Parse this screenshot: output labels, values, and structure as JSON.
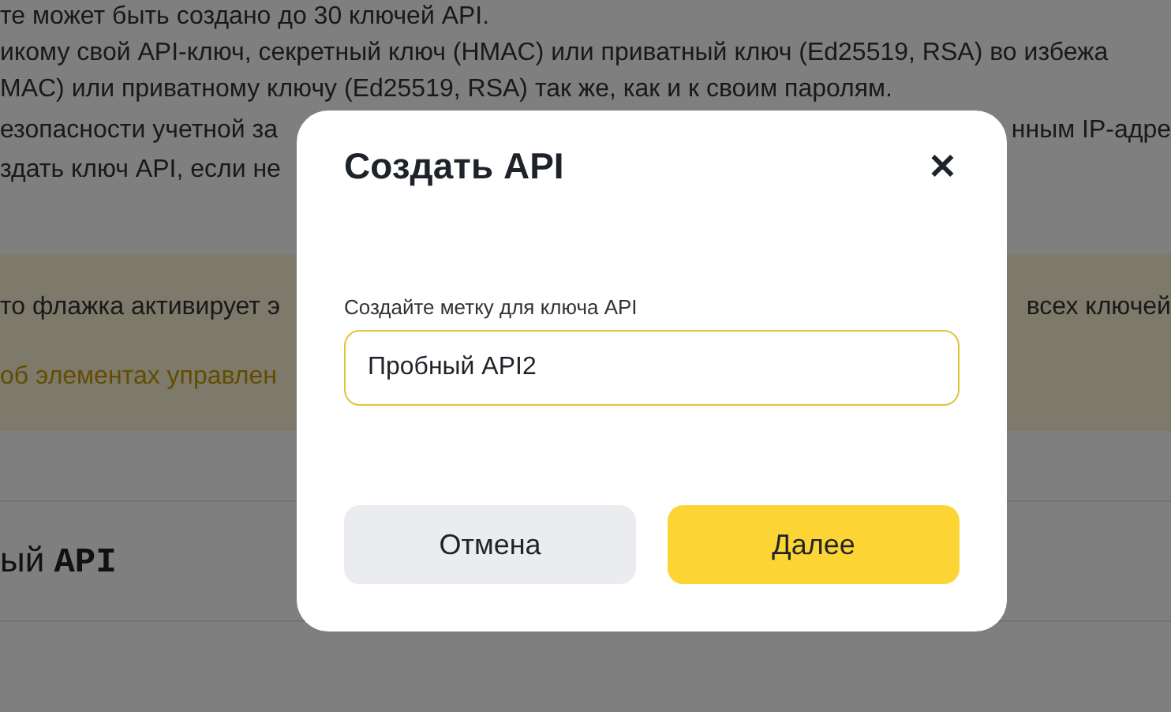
{
  "background": {
    "lines": [
      {
        "left": "те может быть создано до 30 ключей API."
      },
      {
        "left": "икому свой API-ключ, секретный ключ (HMAC) или приватный ключ (Ed25519, RSA) во избежа"
      },
      {
        "left": "MAC) или приватному ключу (Ed25519, RSA) так же, как и к своим паролям."
      },
      {
        "left": "езопасности учетной за",
        "right": "нным IP-адре"
      },
      {
        "left": "здать ключ API, если не"
      }
    ],
    "notice": {
      "text_left": "то флажка активирует э",
      "text_right": "всех ключей",
      "link": "об элементах управлен"
    },
    "section_title": "ый **API**"
  },
  "dialog": {
    "title": "Создать API",
    "close": "✕",
    "field": {
      "label": "Создайте метку для ключа API",
      "value": "Пробный API2"
    },
    "buttons": [
      {
        "kind": "secondary",
        "label": "Отмена"
      },
      {
        "kind": "primary",
        "label": "Далее"
      }
    ]
  }
}
